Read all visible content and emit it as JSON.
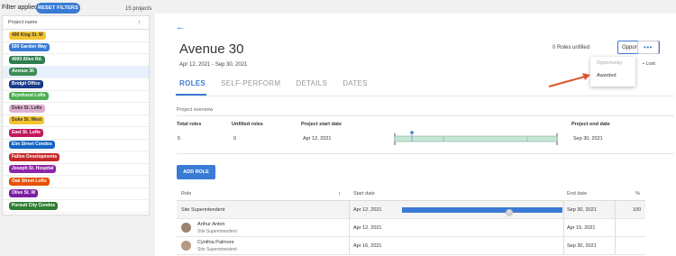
{
  "filter": {
    "label": "Filter applied",
    "reset_label": "RESET FILTERS",
    "count": "15 projects"
  },
  "projects": {
    "header": "Project name",
    "items": [
      {
        "label": "400 King St. W",
        "color": "#f4c430",
        "text_color": "#333"
      },
      {
        "label": "500 Garden Way",
        "color": "#3a7bd5",
        "text_color": "#fff"
      },
      {
        "label": "4000 Allen Rd.",
        "color": "#2e7d4f",
        "text_color": "#fff"
      },
      {
        "label": "Avenue 30",
        "color": "#3d8b55",
        "text_color": "#fff"
      },
      {
        "label": "Bridgit Office",
        "color": "#1a3a8a",
        "text_color": "#fff"
      },
      {
        "label": "Brynhurst Lofts",
        "color": "#4caf50",
        "text_color": "#fff"
      },
      {
        "label": "Duke St. Lofts",
        "color": "#e0b0d0",
        "text_color": "#333"
      },
      {
        "label": "Duke St. West",
        "color": "#f4c430",
        "text_color": "#333"
      },
      {
        "label": "East St. Lofts",
        "color": "#c2185b",
        "text_color": "#fff"
      },
      {
        "label": "Elm Street Condos",
        "color": "#1565c0",
        "text_color": "#fff"
      },
      {
        "label": "Fallon Developments",
        "color": "#c62828",
        "text_color": "#fff"
      },
      {
        "label": "Joseph St. Hospital",
        "color": "#8e24aa",
        "text_color": "#fff"
      },
      {
        "label": "Oak Street Lofts",
        "color": "#e65100",
        "text_color": "#fff"
      },
      {
        "label": "Olive St. W",
        "color": "#7b1fa2",
        "text_color": "#fff"
      },
      {
        "label": "Pursuit City Condos",
        "color": "#2e7d32",
        "text_color": "#fff"
      }
    ]
  },
  "project": {
    "title": "Avenue 30",
    "dates": "Apr 12, 2021 - Sep 30, 2021",
    "unfilled": "0 Roles unfilled",
    "status": "Opportunity",
    "more": "•••",
    "menu": [
      "Opportunity",
      "Awarded"
    ],
    "lost": "Lost"
  },
  "tabs": [
    "ROLES",
    "SELF-PERFORM",
    "DETAILS",
    "DATES"
  ],
  "overview": {
    "title": "Project overview",
    "headers": [
      "Total roles",
      "Unfilled roles",
      "Project start date",
      "Project end date"
    ],
    "values": [
      "5",
      "0",
      "Apr 12, 2021",
      "Sep 30, 2021"
    ]
  },
  "add_role": "ADD ROLE",
  "table": {
    "headers": [
      "Role",
      "Start date",
      "End date",
      "%"
    ],
    "rows": [
      {
        "name": "Site Superintendent",
        "sub": "",
        "start": "Apr 12, 2021",
        "end": "Sep 30, 2021",
        "pct": "100"
      },
      {
        "name": "Arthur Anton",
        "sub": "Site Superintendent",
        "start": "Apr 12, 2021",
        "end": "Apr 15, 2021",
        "pct": ""
      },
      {
        "name": "Cynthia Palmore",
        "sub": "Site Superintendent",
        "start": "Apr 16, 2021",
        "end": "Sep 30, 2021",
        "pct": ""
      }
    ]
  },
  "colors": {
    "accent": "#3a7bd5",
    "timeline_fill": "#c8e6d4",
    "timeline_border": "#7fb397"
  }
}
